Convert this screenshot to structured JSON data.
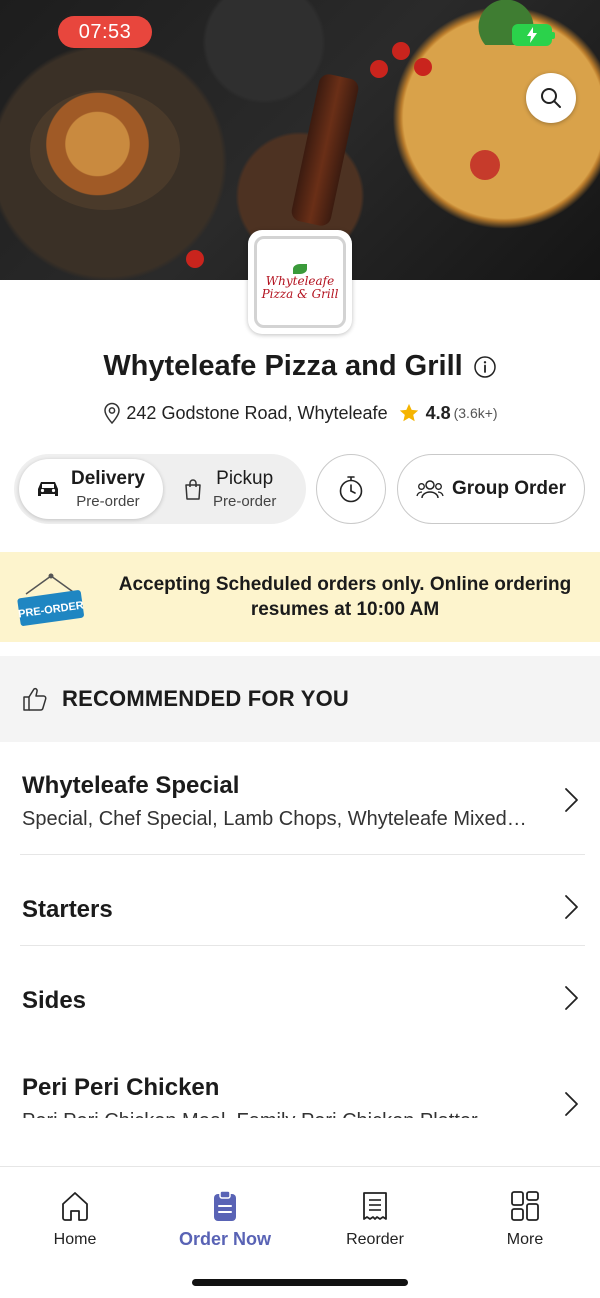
{
  "status_bar": {
    "time": "07:53"
  },
  "restaurant": {
    "logo_text_line1": "Whyteleafe",
    "logo_text_line2": "Pizza & Grill",
    "name": "Whyteleafe Pizza and Grill",
    "address": "242 Godstone Road, Whyteleafe",
    "rating": "4.8",
    "rating_count": "(3.6k+)"
  },
  "order_mode": {
    "delivery": {
      "label": "Delivery",
      "sub": "Pre-order",
      "selected": true
    },
    "pickup": {
      "label": "Pickup",
      "sub": "Pre-order",
      "selected": false
    },
    "group_order_label": "Group Order"
  },
  "banner": {
    "sign_text": "PRE-ORDER",
    "message": "Accepting Scheduled orders only. Online ordering resumes at 10:00 AM"
  },
  "recommended": {
    "title": "RECOMMENDED FOR YOU"
  },
  "menu": [
    {
      "name": "Whyteleafe Special",
      "description": "Special, Chef Special, Lamb Chops, Whyteleafe Mixed Grill"
    },
    {
      "name": "Starters",
      "description": ""
    },
    {
      "name": "Sides",
      "description": ""
    },
    {
      "name": "Peri Peri Chicken",
      "description": "Peri Peri Chicken Meal, Family Peri Chicken Platter"
    }
  ],
  "bottom_nav": {
    "items": [
      {
        "label": "Home",
        "icon": "home-icon",
        "active": false
      },
      {
        "label": "Order Now",
        "icon": "order-clipboard-icon",
        "active": true
      },
      {
        "label": "Reorder",
        "icon": "receipt-icon",
        "active": false
      },
      {
        "label": "More",
        "icon": "grid-icon",
        "active": false
      }
    ]
  },
  "colors": {
    "accent": "#5963b5",
    "banner_bg": "#fdf4cd",
    "time_pill": "#e8463d",
    "battery": "#2bd24b",
    "star": "#f5b400",
    "logo_red": "#b3121f"
  }
}
